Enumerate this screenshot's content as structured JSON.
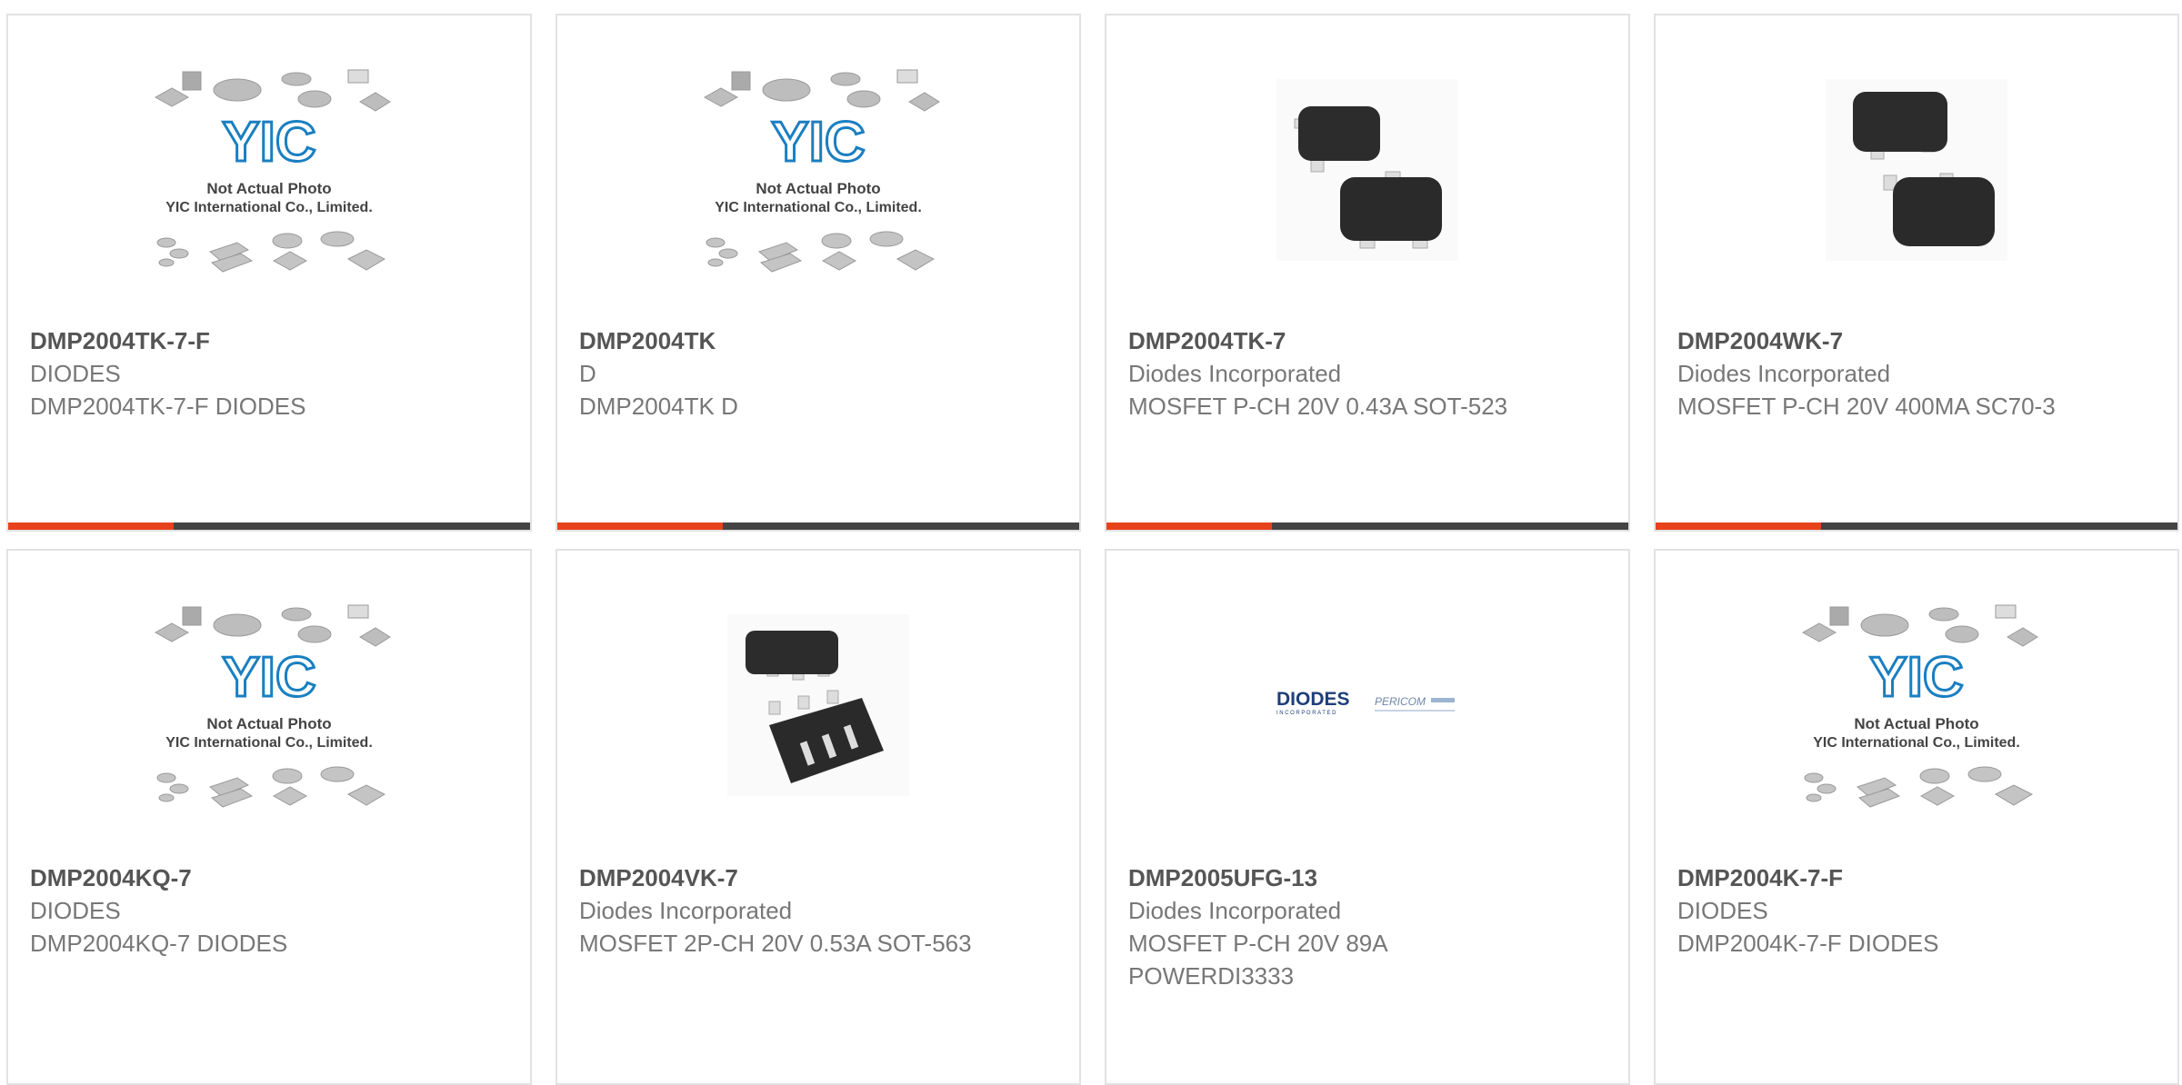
{
  "products": [
    {
      "part_number": "DMP2004TK-7-F",
      "manufacturer": "DIODES",
      "description": "DMP2004TK-7-F DIODES",
      "image": "placeholder-yic"
    },
    {
      "part_number": "DMP2004TK",
      "manufacturer": "D",
      "description": "DMP2004TK D",
      "image": "placeholder-yic"
    },
    {
      "part_number": "DMP2004TK-7",
      "manufacturer": "Diodes Incorporated",
      "description": "MOSFET P-CH 20V 0.43A SOT-523",
      "image": "sot523-package"
    },
    {
      "part_number": "DMP2004WK-7",
      "manufacturer": "Diodes Incorporated",
      "description": "MOSFET P-CH 20V 400MA SC70-3",
      "image": "sc70-package"
    },
    {
      "part_number": "DMP2004KQ-7",
      "manufacturer": "DIODES",
      "description": "DMP2004KQ-7 DIODES",
      "image": "placeholder-yic"
    },
    {
      "part_number": "DMP2004VK-7",
      "manufacturer": "Diodes Incorporated",
      "description": "MOSFET 2P-CH 20V 0.53A SOT-563",
      "image": "sot563-package"
    },
    {
      "part_number": "DMP2005UFG-13",
      "manufacturer": "Diodes Incorporated",
      "description": "MOSFET P-CH 20V 89A POWERDI3333",
      "image": "diodes-pericom-logo"
    },
    {
      "part_number": "DMP2004K-7-F",
      "manufacturer": "DIODES",
      "description": "DMP2004K-7-F DIODES",
      "image": "placeholder-yic"
    }
  ],
  "placeholder": {
    "logo_text": "YIC",
    "line1": "Not Actual Photo",
    "line2": "YIC International Co., Limited."
  },
  "logos": {
    "diodes": "DIODES",
    "diodes_sub": "INCORPORATED",
    "pericom": "PERICOM"
  },
  "colors": {
    "accent": "#e8421c",
    "bar": "#444444",
    "yic_blue": "#1a7fc1"
  }
}
